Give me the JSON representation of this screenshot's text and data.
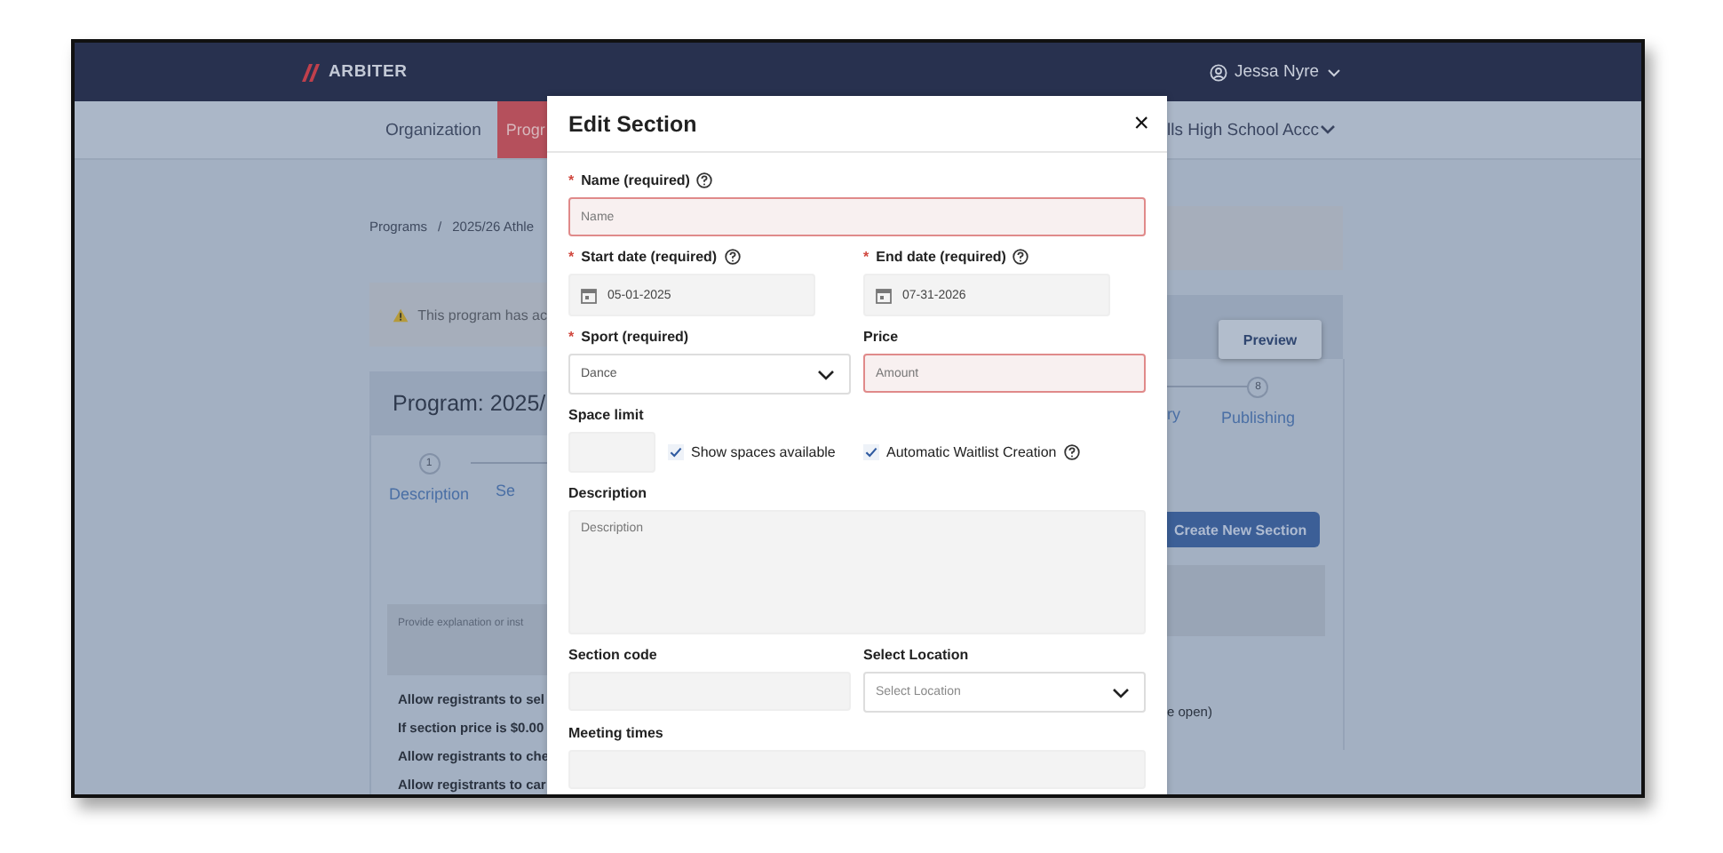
{
  "header": {
    "logo": "ARBITER",
    "user": "Jessa Nyre"
  },
  "nav": {
    "tabs": [
      {
        "label": "Organization",
        "selected": false
      },
      {
        "label": "Progr",
        "selected": true
      }
    ],
    "account": "lls High School Accc"
  },
  "page": {
    "breadcrumb": {
      "items": [
        "Programs",
        "2025/26 Athle"
      ],
      "separator": "/"
    },
    "alert": "This program has ac",
    "title": "Program: 2025/",
    "preview": "Preview",
    "steps": [
      {
        "number": "1",
        "label": "Description"
      },
      {
        "label": "Se"
      },
      {
        "label": "ry"
      },
      {
        "number": "8",
        "label": "Publishing"
      }
    ],
    "create_button": "Create New Section",
    "instructions_placeholder": "Provide explanation or inst",
    "options": [
      "Allow registrants to sel",
      "If section price is $0.00",
      "Allow registrants to che",
      "Allow registrants to car"
    ],
    "option_tail": "e open)"
  },
  "dialog": {
    "title": "Edit Section",
    "close": "×",
    "rows": [
      [
        {
          "kind": "text",
          "label": "Name (required)",
          "mark": "*",
          "help": true,
          "placeholder": "Name",
          "invalid": true
        }
      ],
      [
        {
          "kind": "date",
          "label": "Start date (required)",
          "mark": "*",
          "help": true,
          "value": "05-01-2025"
        },
        {
          "kind": "date",
          "label": "End date (required)",
          "mark": "*",
          "help": true,
          "value": "07-31-2026"
        }
      ],
      [
        {
          "kind": "select",
          "label": "Sport (required)",
          "mark": "*",
          "value": "Dance"
        },
        {
          "kind": "text",
          "label": "Price",
          "placeholder": "Amount",
          "invalid": true
        }
      ],
      [
        {
          "kind": "space",
          "label": "Space limit",
          "checkboxes": [
            {
              "label": "Show spaces available",
              "checked": true,
              "help": false
            },
            {
              "label": "Automatic Waitlist Creation",
              "checked": true,
              "help": true
            }
          ]
        }
      ],
      [
        {
          "kind": "textarea",
          "label": "Description",
          "placeholder": "Description"
        }
      ],
      [
        {
          "kind": "text",
          "label": "Section code",
          "invalid": false
        },
        {
          "kind": "select",
          "label": "Select Location",
          "placeholder": "Select Location"
        }
      ],
      [
        {
          "kind": "text",
          "label": "Meeting times",
          "invalid": false
        }
      ]
    ]
  }
}
